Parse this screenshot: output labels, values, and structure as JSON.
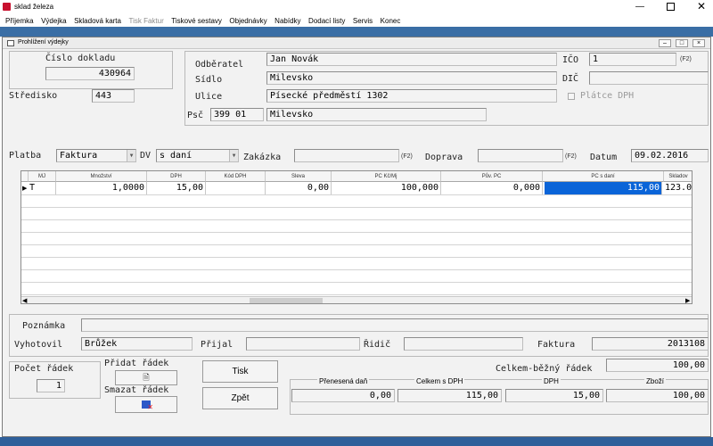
{
  "app": {
    "title": "sklad železa"
  },
  "menu": [
    "Příjemka",
    "Výdejka",
    "Skladová karta",
    "Tisk Faktur",
    "Tiskové sestavy",
    "Objednávky",
    "Nabídky",
    "Dodací listy",
    "Servis",
    "Konec"
  ],
  "window": {
    "title": "Prohlížení výdejky"
  },
  "doc": {
    "cislo_label": "Číslo dokladu",
    "cislo": "430964",
    "stredisko_label": "Středisko",
    "stredisko": "443"
  },
  "partner": {
    "odberatel_label": "Odběratel",
    "odberatel": "Jan Novák",
    "sidlo_label": "Sídlo",
    "sidlo": "Milevsko",
    "ulice_label": "Ulice",
    "ulice": "Písecké předměstí 1302",
    "psc_label": "Psč",
    "psc": "399 01",
    "obec": "Milevsko",
    "ico_label": "IČO",
    "ico": "1",
    "ico_f2": "(F2)",
    "dic_label": "DIČ",
    "dic": "",
    "platce_label": "Plátce DPH"
  },
  "order": {
    "platba_label": "Platba",
    "platba": "Faktura",
    "dv_label": "DV",
    "dv": "s daní",
    "zakazka_label": "Zakázka",
    "zakazka": "",
    "zakazka_f2": "(F2)",
    "doprava_label": "Doprava",
    "doprava": "",
    "doprava_f2": "(F2)",
    "datum_label": "Datum",
    "datum": "09.02.2016"
  },
  "grid": {
    "columns": [
      "MJ",
      "Množství",
      "DPH",
      "Kód DPH",
      "Sleva",
      "PC  Kč/Mj",
      "Pův. PC",
      "PC s daní",
      "Skladov"
    ],
    "rows": [
      [
        "T",
        "1,0000",
        "15,00",
        "",
        "0,00",
        "100,000",
        "0,000",
        "115,00",
        "123.0"
      ]
    ]
  },
  "footer": {
    "poznamka_label": "Poznámka",
    "poznamka": "",
    "vyhotovil_label": "Vyhotovil",
    "vyhotovil": "Brůžek",
    "prijal_label": "Přijal",
    "prijal": "",
    "ridic_label": "Řidič",
    "ridic": "",
    "faktura_label": "Faktura",
    "faktura": "2013108",
    "pocet_label": "Počet řádek",
    "pocet": "1",
    "pridat_label": "Přidat řádek",
    "smazat_label": "Smazat řádek",
    "tisk": "Tisk",
    "zpet": "Zpět",
    "celkem_bezny_label": "Celkem-běžný řádek",
    "celkem_bezny": "100,00",
    "prenesena_label": "Přenesená daň",
    "prenesena": "0,00",
    "celkem_dph_label": "Celkem s DPH",
    "celkem_dph": "115,00",
    "dph_label": "DPH",
    "dph": "15,00",
    "zbozi_label": "Zboží",
    "zbozi": "100,00"
  }
}
